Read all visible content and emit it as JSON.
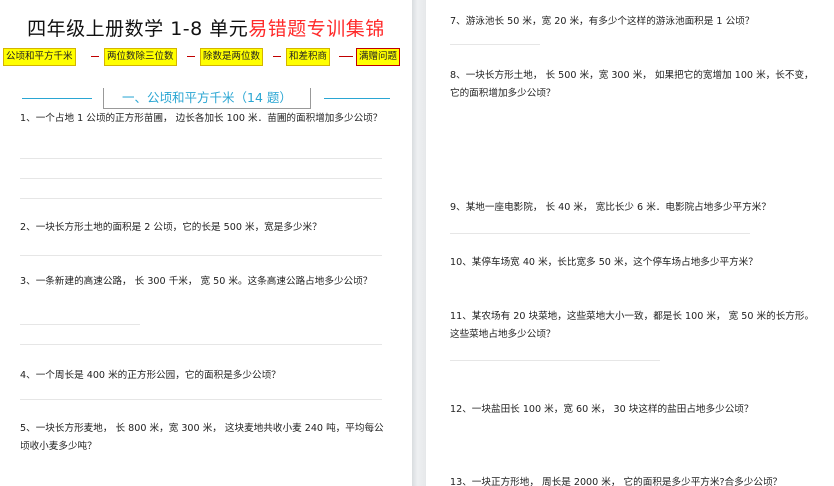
{
  "title": {
    "black": "四年级上册数学 1-8 单元",
    "red": "易错题专训集锦"
  },
  "tags": [
    "公顷和平方千米",
    "两位数除三位数",
    "除数是两位数",
    "和差积商",
    "满赠问题"
  ],
  "section": {
    "heading": "一、公顷和平方千米（14 题）"
  },
  "left_questions": [
    "1、一个占地 1 公顷的正方形苗圃， 边长各加长 100 米．苗圃的面积增加多少公顷？",
    "2、一块长方形土地的面积是 2 公顷，它的长是 500 米，宽是多少米？",
    "3、一条新建的高速公路， 长 300 千米， 宽 50 米。这条高速公路占地多少公顷？",
    "4、一个周长是 400 米的正方形公园，它的面积是多少公顷？",
    "5、一块长方形麦地， 长 800 米，宽 300 米， 这块麦地共收小麦 240 吨，平均每公顷收小麦多少吨？"
  ],
  "right_questions": [
    "7、游泳池长 50 米，宽 20 米，有多少个这样的游泳池面积是 1 公顷？",
    "8、一块长方形土地， 长 500 米，宽 300 米， 如果把它的宽增加 100 米，长不变，它的面积增加多少公顷？",
    "9、某地一座电影院， 长 40 米， 宽比长少 6 米．电影院占地多少平方米？",
    "10、某停车场宽 40 米，长比宽多 50 米，这个停车场占地多少平方米？",
    "11、某农场有 20 块菜地，这些菜地大小一致，都是长 100 米， 宽 50 米的长方形。这些菜地占地多少公顷？",
    "12、一块盐田长 100 米，宽 60 米， 30 块这样的盐田占地多少公顷？",
    "13、一块正方形地， 周长是 2000 米， 它的面积是多少平方米?合多少公顷？"
  ]
}
